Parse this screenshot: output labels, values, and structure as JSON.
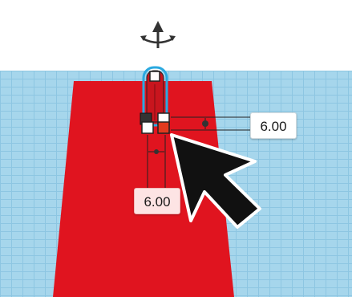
{
  "colors": {
    "workplane": "#a6d6ec",
    "grid_line": "#8dc6e2",
    "shape_fill": "#e0141f",
    "selection_outline": "#2aa9e0",
    "handle_dark": "#333333",
    "handle_active": "#e23a1e"
  },
  "dimensions": {
    "width_value": "6.00",
    "depth_value": "6.00"
  },
  "icons": {
    "rotate_handle": "cone-lift-icon",
    "pointer": "mouse-cursor-icon"
  }
}
